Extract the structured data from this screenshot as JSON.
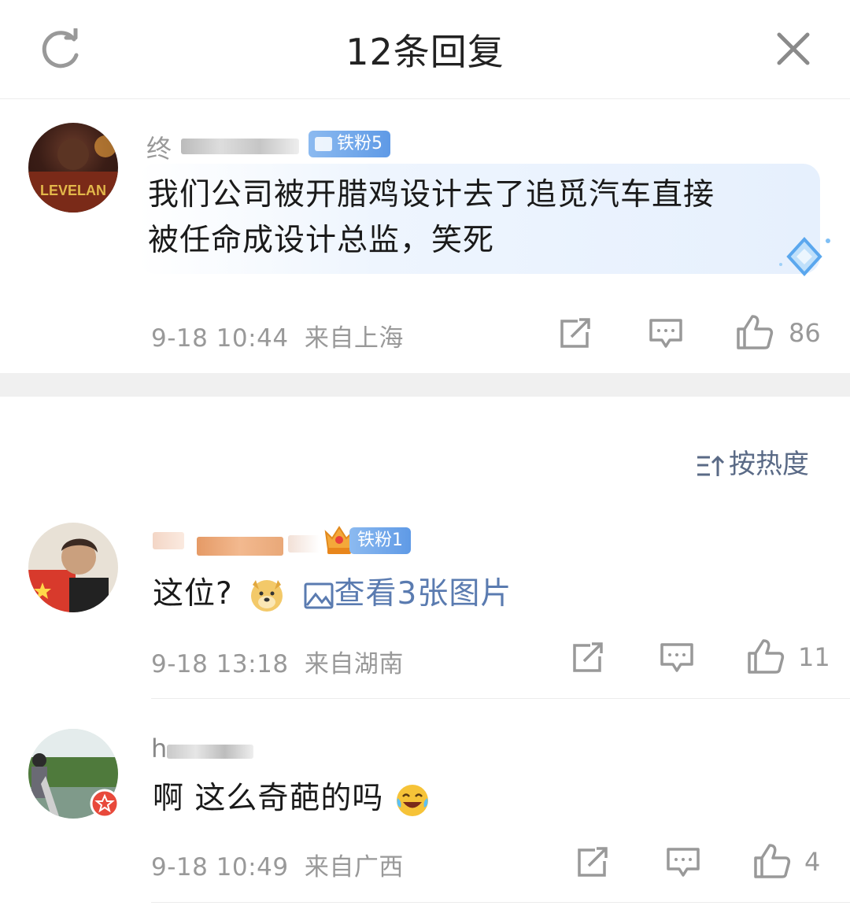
{
  "header": {
    "title": "12条回复"
  },
  "root_comment": {
    "username_visible": "终",
    "badge": "铁粉5",
    "text_line1": "我们公司被开腊鸡设计去了追觅汽车直接",
    "text_line2": "被任命成设计总监，笑死",
    "time": "9-18 10:44",
    "location": "来自上海",
    "likes": "86"
  },
  "sort": {
    "label": "按热度"
  },
  "replies": [
    {
      "badge": "铁粉1",
      "text": "这位?",
      "image_link": "查看3张图片",
      "time": "9-18 13:18",
      "location": "来自湖南",
      "likes": "11"
    },
    {
      "username_visible": "h",
      "text": "啊 这么奇葩的吗",
      "time": "9-18 10:49",
      "location": "来自广西",
      "likes": "4"
    }
  ],
  "icons": [
    "refresh-icon",
    "close-icon",
    "share-icon",
    "comment-icon",
    "like-icon",
    "sort-icon",
    "image-icon",
    "doge-emoji",
    "laugh-emoji"
  ],
  "colors": {
    "accent": "#5a7bb0",
    "badge": "#6fa4ea",
    "meta": "#999999"
  }
}
